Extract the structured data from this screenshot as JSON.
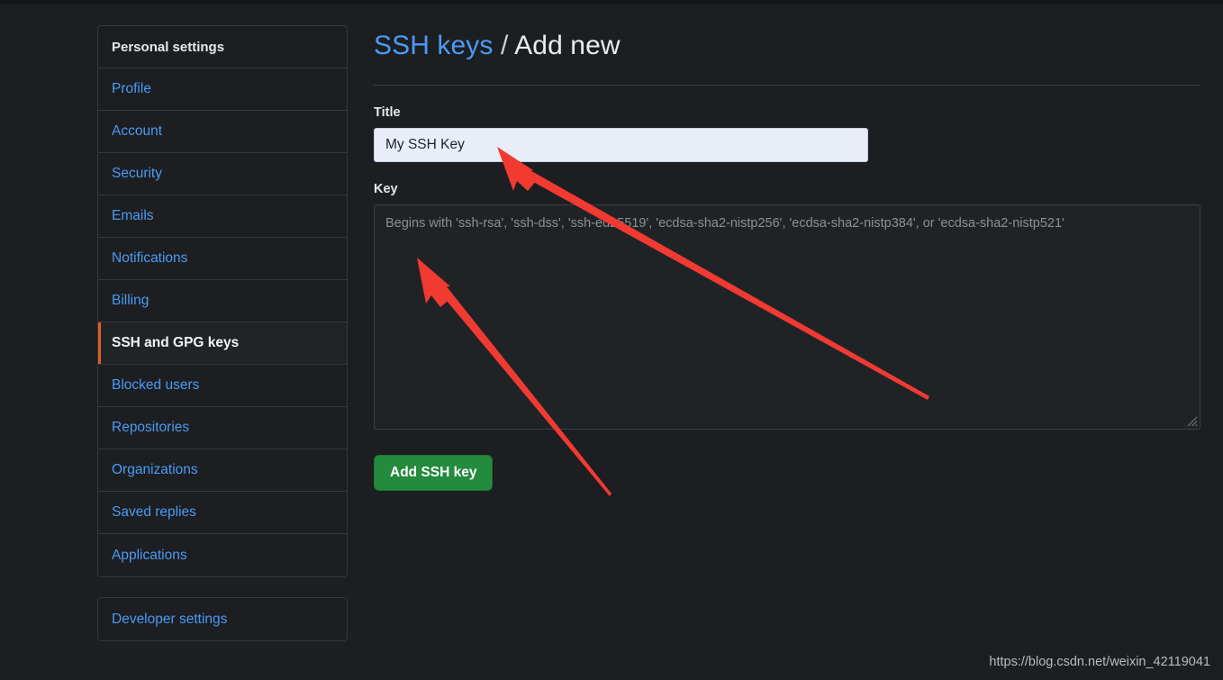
{
  "sidebar": {
    "primary": [
      {
        "label": "Personal settings",
        "type": "header"
      },
      {
        "label": "Profile",
        "type": "link"
      },
      {
        "label": "Account",
        "type": "link"
      },
      {
        "label": "Security",
        "type": "link"
      },
      {
        "label": "Emails",
        "type": "link"
      },
      {
        "label": "Notifications",
        "type": "link"
      },
      {
        "label": "Billing",
        "type": "link"
      },
      {
        "label": "SSH and GPG keys",
        "type": "active"
      },
      {
        "label": "Blocked users",
        "type": "link"
      },
      {
        "label": "Repositories",
        "type": "link"
      },
      {
        "label": "Organizations",
        "type": "link"
      },
      {
        "label": "Saved replies",
        "type": "link"
      },
      {
        "label": "Applications",
        "type": "link"
      }
    ],
    "secondary": [
      {
        "label": "Developer settings",
        "type": "link"
      }
    ],
    "active_accent_color": "#e05d28",
    "link_color": "#4a9bf5"
  },
  "header": {
    "breadcrumb_link": "SSH keys",
    "breadcrumb_separator": "/",
    "breadcrumb_current": "Add new"
  },
  "form": {
    "title_label": "Title",
    "title_value": "My SSH Key",
    "title_placeholder": "",
    "key_label": "Key",
    "key_value": "",
    "key_placeholder": "Begins with 'ssh-rsa', 'ssh-dss', 'ssh-ed25519', 'ecdsa-sha2-nistp256', 'ecdsa-sha2-nistp384', or 'ecdsa-sha2-nistp521'",
    "submit_label": "Add SSH key",
    "submit_color": "#248a3d"
  },
  "annotations": {
    "arrow_color": "#f03a32",
    "arrow_title_desc": "red-arrow-pointing-to-title-input",
    "arrow_key_desc": "red-arrow-pointing-to-key-textarea"
  },
  "watermark": {
    "text": "https://blog.csdn.net/weixin_42119041"
  }
}
